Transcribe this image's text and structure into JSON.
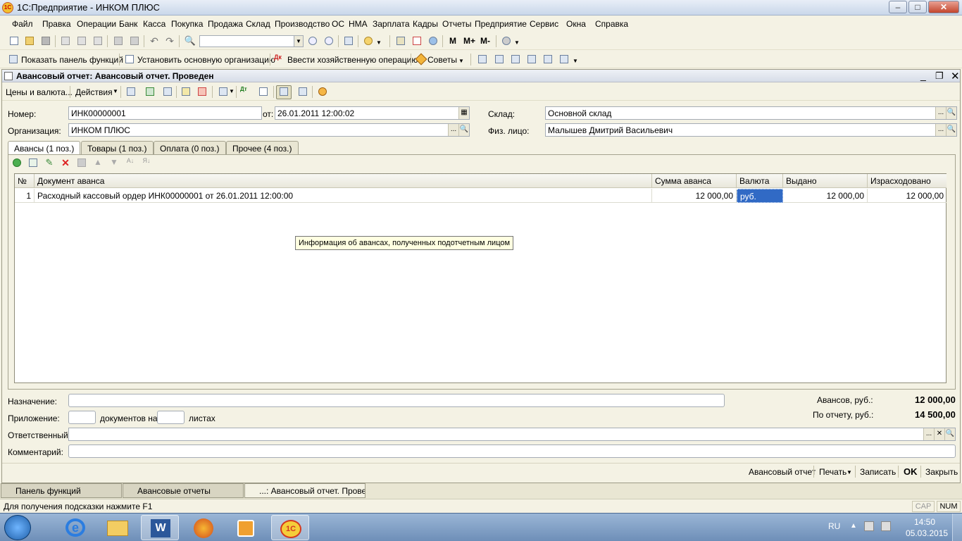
{
  "window": {
    "title": "1С:Предприятие - ИНКОМ ПЛЮС",
    "minimize": "‒",
    "maximize": "□",
    "close": "✕"
  },
  "menu": [
    "Файл",
    "Правка",
    "Операции",
    "Банк",
    "Касса",
    "Покупка",
    "Продажа",
    "Склад",
    "Производство",
    "ОС",
    "НМА",
    "Зарплата",
    "Кадры",
    "Отчеты",
    "Предприятие",
    "Сервис",
    "Окна",
    "Справка"
  ],
  "toolbar2": {
    "m": "M",
    "mplus": "M+",
    "mminus": "M-"
  },
  "toolbar3": {
    "show_panel": "Показать панель функций",
    "set_org": "Установить основную организацию",
    "enter_op": "Ввести хозяйственную операцию",
    "tips": "Советы"
  },
  "doc": {
    "title": "Авансовый отчет: Авансовый отчет. Проведен",
    "toolbar": {
      "prices": "Цены и валюта...",
      "actions": "Действия"
    },
    "number_label": "Номер:",
    "number": "ИНК00000001",
    "date_label": "от:",
    "date": "26.01.2011 12:00:02",
    "warehouse_label": "Склад:",
    "warehouse": "Основной склад",
    "org_label": "Организация:",
    "org": "ИНКОМ ПЛЮС",
    "person_label": "Физ. лицо:",
    "person": "Малышев Дмитрий  Васильевич",
    "tabs": [
      "Авансы (1 поз.)",
      "Товары (1 поз.)",
      "Оплата (0 поз.)",
      "Прочее (4 поз.)"
    ],
    "table": {
      "columns": [
        "№",
        "Документ аванса",
        "Сумма аванса",
        "Валюта",
        "Выдано",
        "Израсходовано"
      ],
      "rows": [
        {
          "n": "1",
          "doc": "Расходный кассовый ордер ИНК00000001 от 26.01.2011 12:00:00",
          "sum": "12 000,00",
          "currency": "руб.",
          "issued": "12 000,00",
          "spent": "12 000,00"
        }
      ]
    },
    "tooltip": "Информация об авансах, полученных подотчетным лицом",
    "purpose_label": "Назначение:",
    "attach_label": "Приложение:",
    "docs_on": "документов на",
    "sheets": "листах",
    "responsible_label": "Ответственный:",
    "comment_label": "Комментарий:",
    "advances_label": "Авансов, руб.:",
    "advances_value": "12 000,00",
    "report_label": "По отчету, руб.:",
    "report_value": "14 500,00",
    "buttons": {
      "report": "Авансовый отчет",
      "print": "Печать",
      "save": "Записать",
      "ok": "OK",
      "close": "Закрыть"
    }
  },
  "tasktabs": [
    "Панель функций",
    "Авансовые отчеты",
    "...: Авансовый отчет. Прове..."
  ],
  "status": {
    "hint": "Для получения подсказки нажмите F1",
    "cap": "CAP",
    "num": "NUM"
  },
  "taskbar": {
    "lang": "RU",
    "time": "14:50",
    "date": "05.03.2015"
  }
}
